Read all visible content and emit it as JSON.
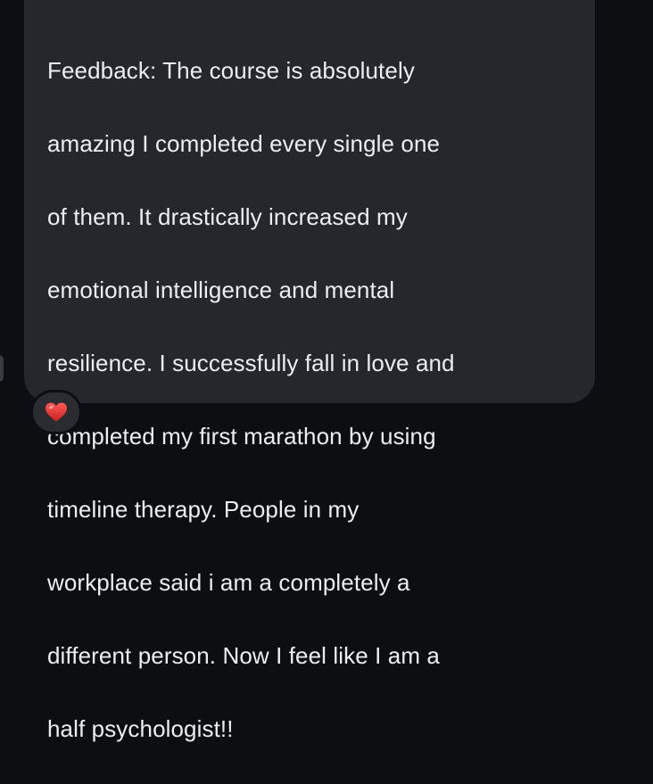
{
  "message": {
    "lines": [
      "Feedback: The course is absolutely",
      "amazing I completed every single one",
      "of them. It drastically increased my",
      "emotional intelligence and mental",
      "resilience. I successfully fall in love and",
      "completed my first marathon by using",
      "timeline therapy. People in my",
      "workplace said i am a completely a",
      "different person. Now I feel like I am a",
      "half psychologist!!"
    ]
  },
  "reaction": {
    "icon": "heart-icon",
    "color": "#e8312f"
  },
  "colors": {
    "background": "#0d0e11",
    "bubble": "#26272c",
    "text": "#ecedf0"
  }
}
